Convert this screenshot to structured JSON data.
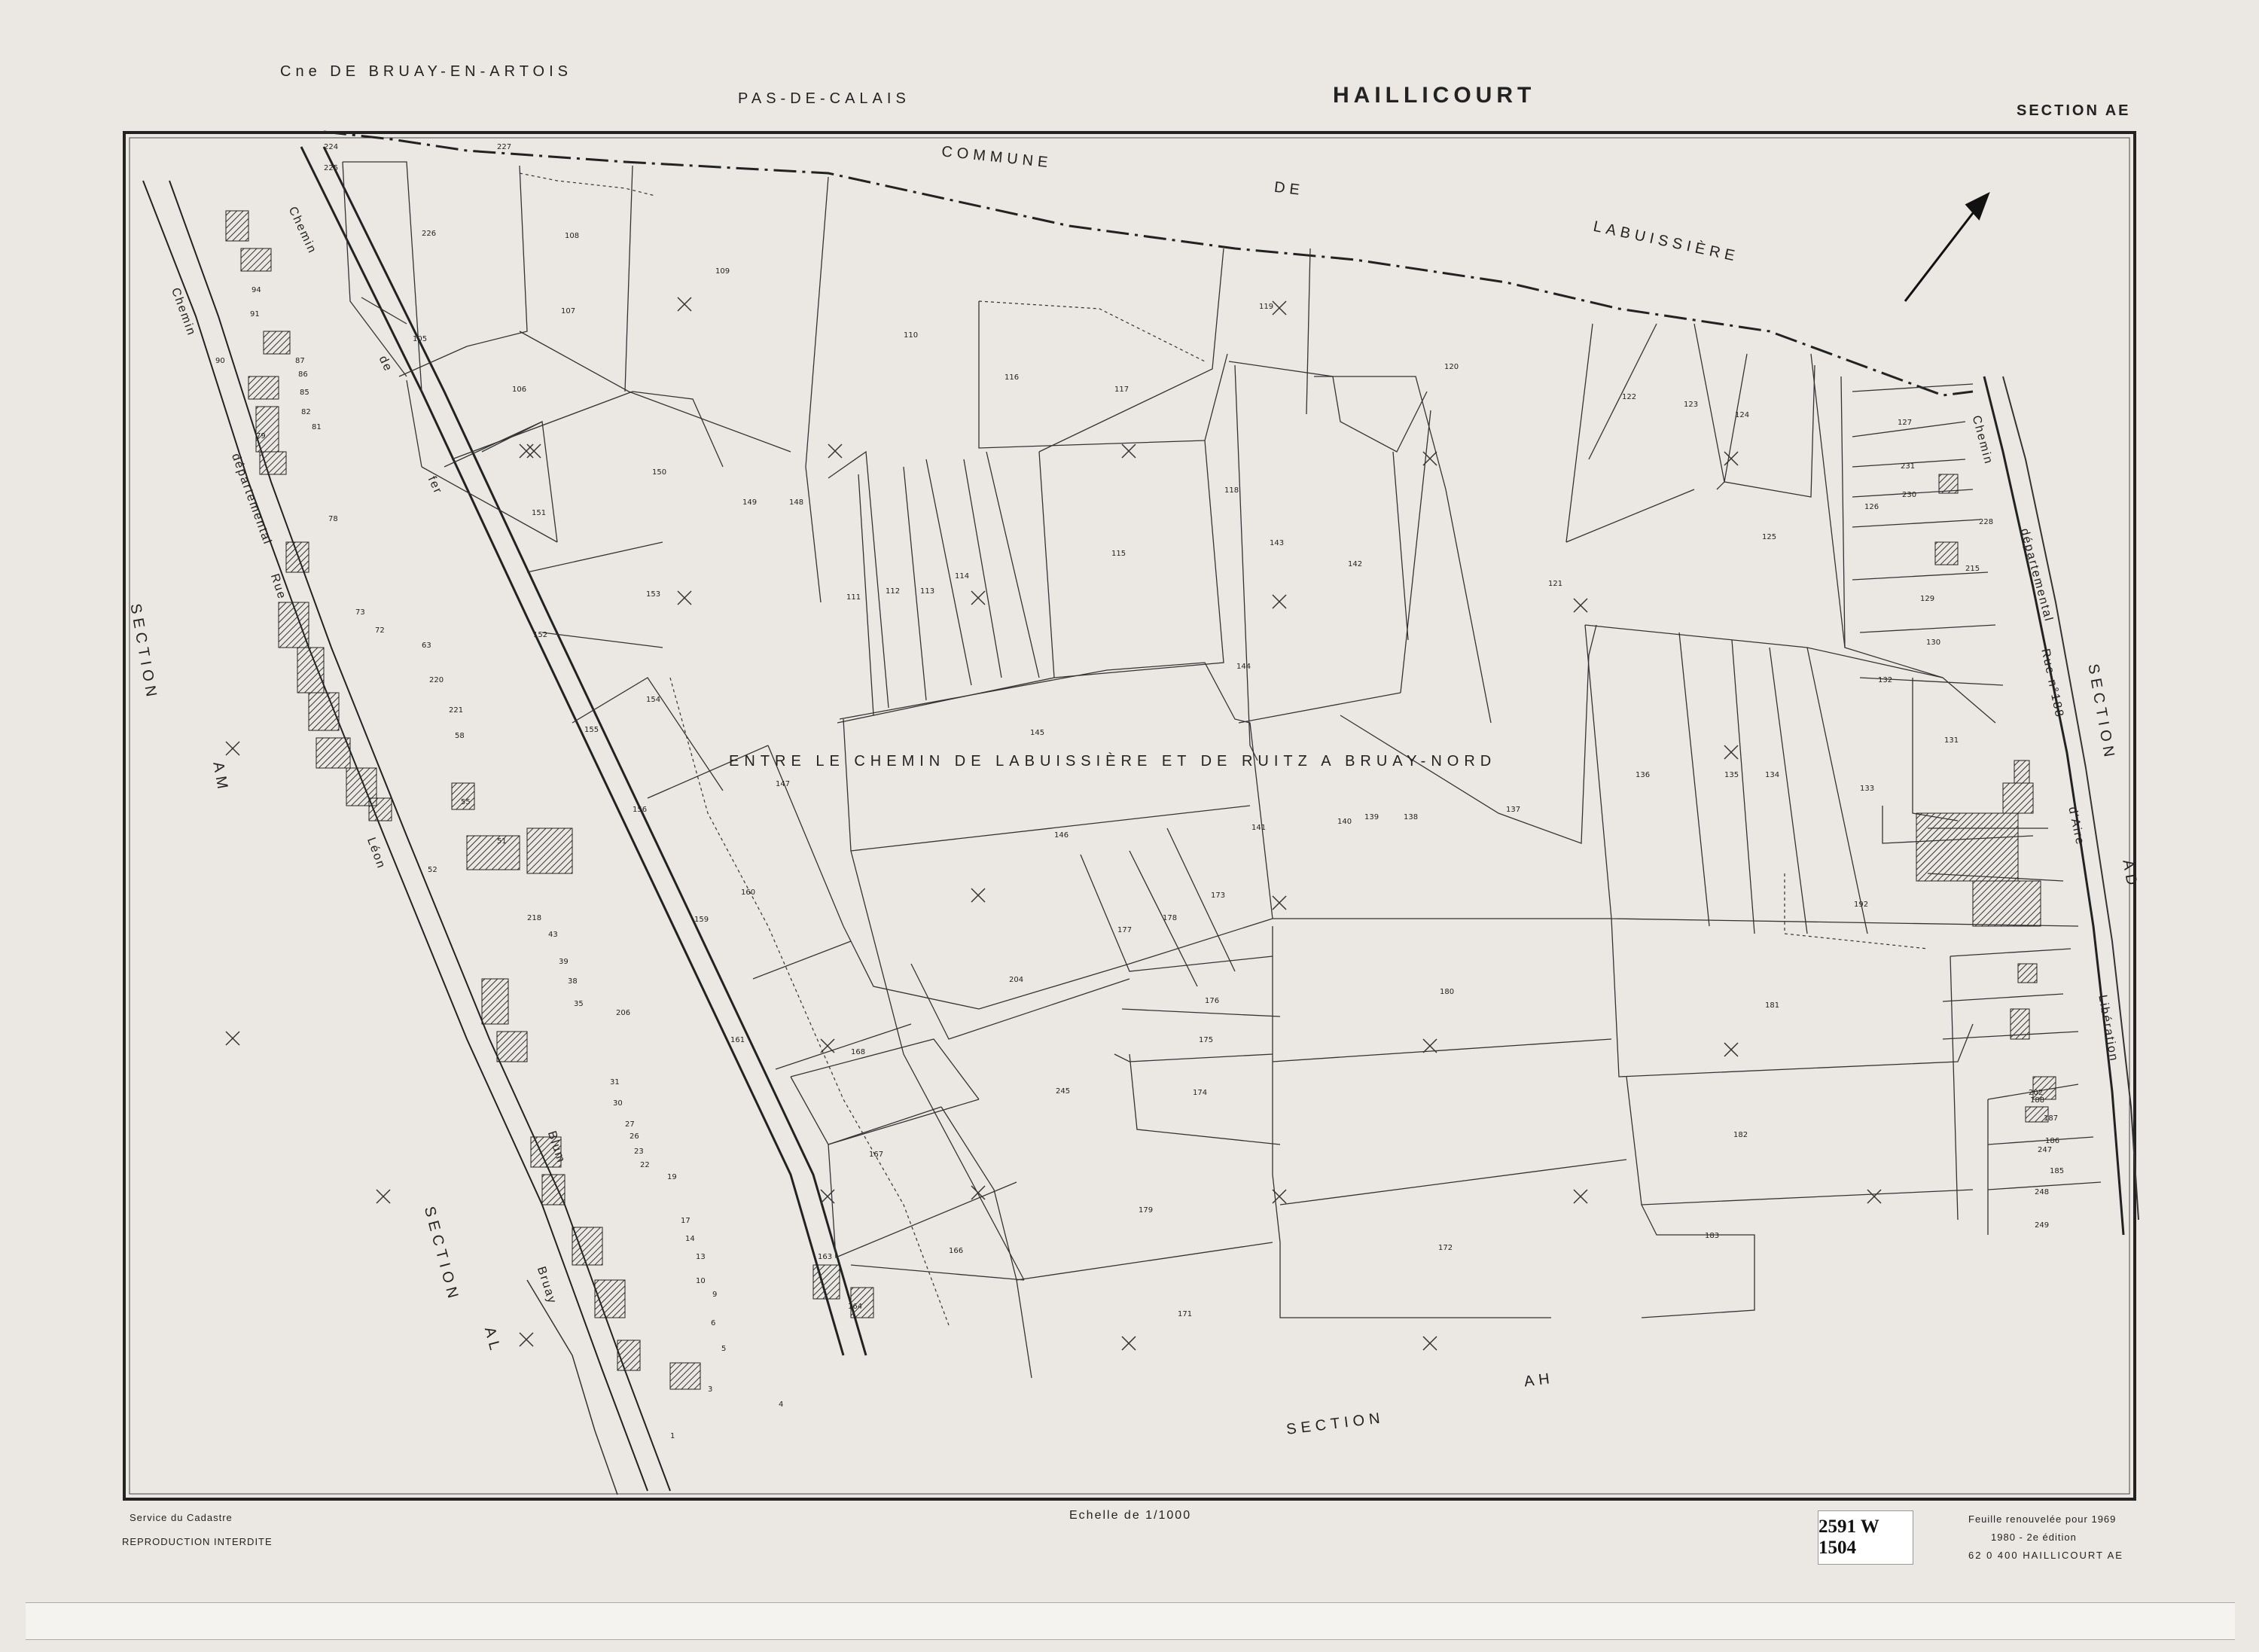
{
  "header": {
    "commune_left": "Cne DE BRUAY-EN-ARTOIS",
    "department": "PAS-DE-CALAIS",
    "commune": "HAILLICOURT",
    "section": "SECTION AE"
  },
  "labels": {
    "commune_top": "COMMUNE",
    "de": "DE",
    "labuissiere": "LABUISSIÈRE",
    "locality": "ENTRE LE CHEMIN DE LABUISSIÈRE ET DE RUITZ A BRUAY-NORD",
    "section_word": "SECTION",
    "am": "AM",
    "al": "AL",
    "ah": "AH",
    "ad": "AD",
    "chemin": "Chemin",
    "de_small": "de",
    "fer": "fer",
    "departemental": "départemental",
    "rue": "Rue",
    "leon": "Léon",
    "blum": "Blum",
    "bruay": "Bruay",
    "rue_188": "Rue n°188",
    "d_aire": "d'Aire",
    "liberation": "Libération"
  },
  "footer": {
    "service": "Service du Cadastre",
    "reproduction": "REPRODUCTION INTERDITE",
    "scale": "Echelle de 1/1000",
    "renewal": "Feuille renouvelée pour 1969",
    "edition": "1980 - 2e édition",
    "code": "62 0 400  HAILLICOURT  AE",
    "archive_ref": "2591 W 1504"
  },
  "parcels": [
    {
      "n": "224"
    },
    {
      "n": "225"
    },
    {
      "n": "227"
    },
    {
      "n": "226"
    },
    {
      "n": "108"
    },
    {
      "n": "107"
    },
    {
      "n": "109"
    },
    {
      "n": "110"
    },
    {
      "n": "105"
    },
    {
      "n": "106"
    },
    {
      "n": "116"
    },
    {
      "n": "117"
    },
    {
      "n": "119"
    },
    {
      "n": "120"
    },
    {
      "n": "122"
    },
    {
      "n": "123"
    },
    {
      "n": "124"
    },
    {
      "n": "127"
    },
    {
      "n": "150"
    },
    {
      "n": "151"
    },
    {
      "n": "149"
    },
    {
      "n": "148"
    },
    {
      "n": "111"
    },
    {
      "n": "112"
    },
    {
      "n": "113"
    },
    {
      "n": "114"
    },
    {
      "n": "115"
    },
    {
      "n": "118"
    },
    {
      "n": "143"
    },
    {
      "n": "142"
    },
    {
      "n": "121"
    },
    {
      "n": "125"
    },
    {
      "n": "126"
    },
    {
      "n": "129"
    },
    {
      "n": "130"
    },
    {
      "n": "153"
    },
    {
      "n": "152"
    },
    {
      "n": "154"
    },
    {
      "n": "155"
    },
    {
      "n": "145"
    },
    {
      "n": "144"
    },
    {
      "n": "147"
    },
    {
      "n": "146"
    },
    {
      "n": "141"
    },
    {
      "n": "140"
    },
    {
      "n": "139"
    },
    {
      "n": "138"
    },
    {
      "n": "137"
    },
    {
      "n": "136"
    },
    {
      "n": "135"
    },
    {
      "n": "134"
    },
    {
      "n": "133"
    },
    {
      "n": "132"
    },
    {
      "n": "131"
    },
    {
      "n": "156"
    },
    {
      "n": "160"
    },
    {
      "n": "159"
    },
    {
      "n": "173"
    },
    {
      "n": "178"
    },
    {
      "n": "177"
    },
    {
      "n": "204"
    },
    {
      "n": "176"
    },
    {
      "n": "175"
    },
    {
      "n": "174"
    },
    {
      "n": "180"
    },
    {
      "n": "181"
    },
    {
      "n": "192"
    },
    {
      "n": "161"
    },
    {
      "n": "168"
    },
    {
      "n": "167"
    },
    {
      "n": "166"
    },
    {
      "n": "245"
    },
    {
      "n": "179"
    },
    {
      "n": "172"
    },
    {
      "n": "171"
    },
    {
      "n": "182"
    },
    {
      "n": "183"
    },
    {
      "n": "247"
    },
    {
      "n": "248"
    },
    {
      "n": "249"
    },
    {
      "n": "220"
    },
    {
      "n": "221"
    },
    {
      "n": "79"
    },
    {
      "n": "78"
    },
    {
      "n": "73"
    },
    {
      "n": "72"
    },
    {
      "n": "63"
    },
    {
      "n": "58"
    },
    {
      "n": "55"
    },
    {
      "n": "51"
    },
    {
      "n": "52"
    },
    {
      "n": "218"
    },
    {
      "n": "43"
    },
    {
      "n": "39"
    },
    {
      "n": "38"
    },
    {
      "n": "35"
    },
    {
      "n": "206"
    },
    {
      "n": "31"
    },
    {
      "n": "30"
    },
    {
      "n": "27"
    },
    {
      "n": "26"
    },
    {
      "n": "23"
    },
    {
      "n": "22"
    },
    {
      "n": "19"
    },
    {
      "n": "17"
    },
    {
      "n": "14"
    },
    {
      "n": "13"
    },
    {
      "n": "10"
    },
    {
      "n": "9"
    },
    {
      "n": "6"
    },
    {
      "n": "5"
    },
    {
      "n": "3"
    },
    {
      "n": "4"
    },
    {
      "n": "1"
    },
    {
      "n": "90"
    },
    {
      "n": "91"
    },
    {
      "n": "87"
    },
    {
      "n": "86"
    },
    {
      "n": "85"
    },
    {
      "n": "82"
    },
    {
      "n": "81"
    },
    {
      "n": "94"
    },
    {
      "n": "231"
    },
    {
      "n": "230"
    },
    {
      "n": "215"
    },
    {
      "n": "228"
    },
    {
      "n": "202"
    },
    {
      "n": "188"
    },
    {
      "n": "187"
    },
    {
      "n": "186"
    },
    {
      "n": "185"
    },
    {
      "n": "163"
    },
    {
      "n": "164"
    }
  ]
}
